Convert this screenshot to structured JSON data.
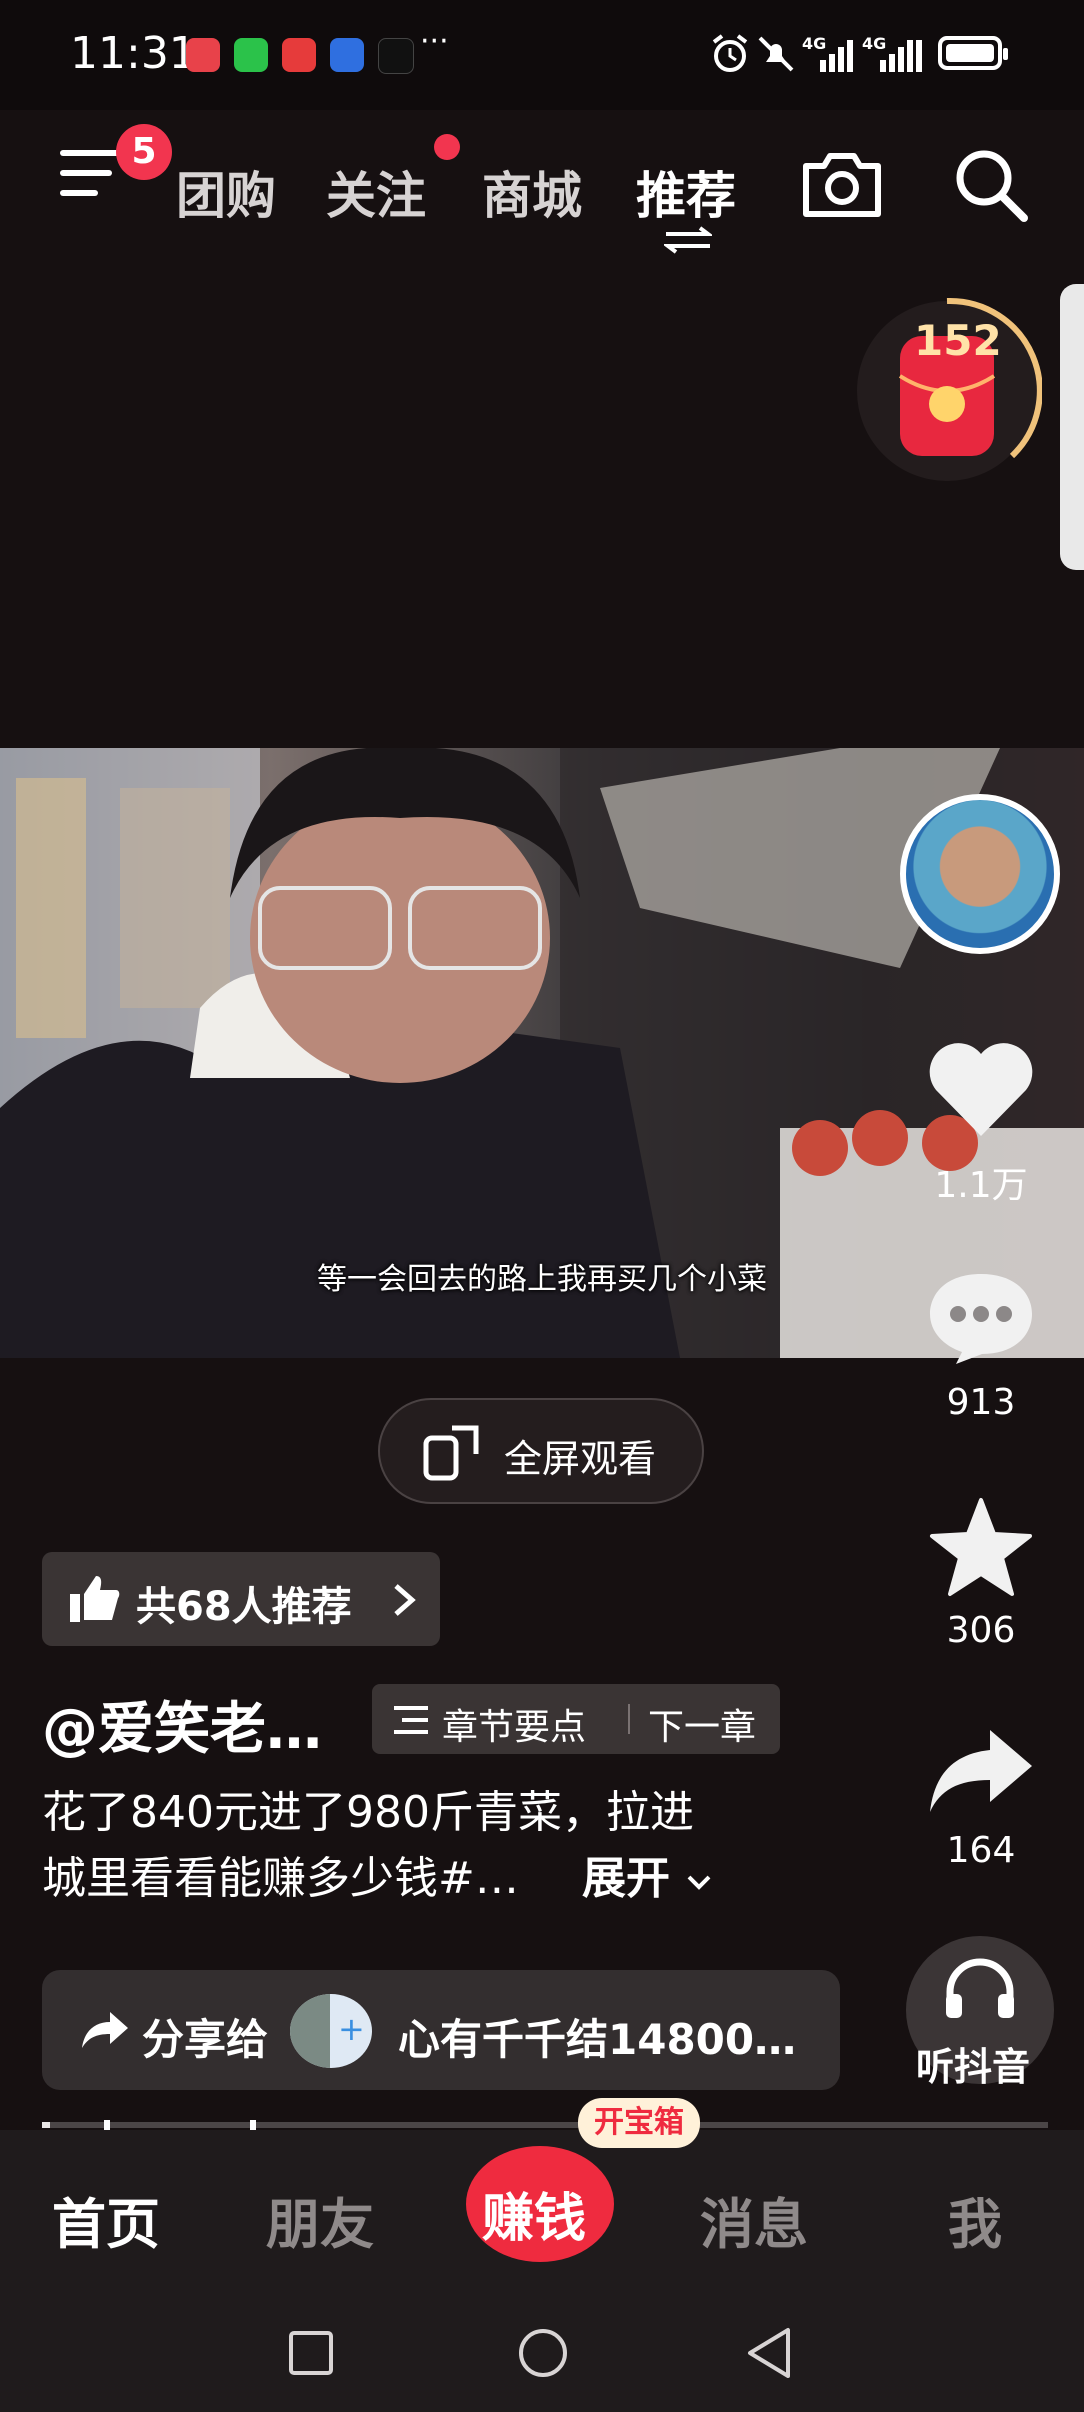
{
  "status_bar": {
    "time": "11:31",
    "more_indicator": "···",
    "network_1": "4G",
    "network_2": "4G",
    "icons": [
      "alarm-icon",
      "mute-icon",
      "signal-icon",
      "battery-icon"
    ]
  },
  "top_nav": {
    "menu_badge": "5",
    "tabs": [
      {
        "label": "团购"
      },
      {
        "label": "关注"
      },
      {
        "label": "商城"
      },
      {
        "label": "推荐"
      }
    ]
  },
  "gift_timer": {
    "count": "152"
  },
  "video": {
    "subtitle": "等一会回去的路上我再买几个小菜"
  },
  "right_rail": {
    "likes": "1.1万",
    "comments": "913",
    "favorites": "306",
    "shares": "164",
    "listen_label": "听抖音"
  },
  "fullscreen": {
    "label": "全屏观看"
  },
  "recommend": {
    "label": "共68人推荐"
  },
  "post": {
    "author": "@爱笑老…",
    "chapters_label": "章节要点",
    "next_chapter": "下一章",
    "desc_line1": "花了840元进了980斤青菜，拉进",
    "desc_line2": "城里看看能赚多少钱#…",
    "expand_label": "展开"
  },
  "share": {
    "label": "分享给",
    "target": "心有千千结14800…"
  },
  "bottom_tabs": {
    "home": "首页",
    "friends": "朋友",
    "earn": "赚钱",
    "treasure": "开宝箱",
    "messages": "消息",
    "me": "我"
  },
  "colors": {
    "background": "#161011",
    "accent_red": "#f2354f",
    "earn_red": "#ef2b3f"
  }
}
